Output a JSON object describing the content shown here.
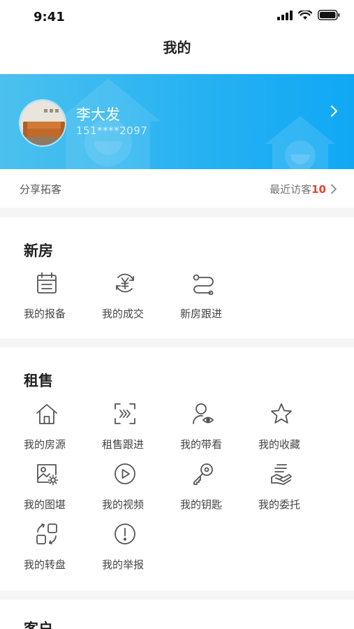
{
  "status_bar": {
    "time": "9:41"
  },
  "nav": {
    "title": "我的"
  },
  "profile": {
    "name": "李大发",
    "phone": "151****2097"
  },
  "share_bar": {
    "share_label": "分享拓客",
    "visitors_label": "最近访客",
    "visitors_count": "10"
  },
  "sections": {
    "new_house": {
      "title": "新房",
      "items": [
        {
          "label": "我的报备",
          "icon": "calendar-icon"
        },
        {
          "label": "我的成交",
          "icon": "yuan-exchange-icon"
        },
        {
          "label": "新房跟进",
          "icon": "route-icon"
        }
      ]
    },
    "rental_sale": {
      "title": "租售",
      "items": [
        {
          "label": "我的房源",
          "icon": "house-icon"
        },
        {
          "label": "租售跟进",
          "icon": "scan-follow-icon"
        },
        {
          "label": "我的带看",
          "icon": "user-eye-icon"
        },
        {
          "label": "我的收藏",
          "icon": "star-icon"
        },
        {
          "label": "我的图堪",
          "icon": "image-settings-icon"
        },
        {
          "label": "我的视频",
          "icon": "play-circle-icon"
        },
        {
          "label": "我的钥匙",
          "icon": "key-icon"
        },
        {
          "label": "我的委托",
          "icon": "hand-document-icon"
        },
        {
          "label": "我的转盘",
          "icon": "transfer-icon"
        },
        {
          "label": "我的举报",
          "icon": "alert-circle-icon"
        }
      ]
    },
    "customer": {
      "title": "客户"
    }
  },
  "colors": {
    "accent": "#1aaef3",
    "highlight": "#e8432e",
    "icon_stroke": "#555555"
  }
}
